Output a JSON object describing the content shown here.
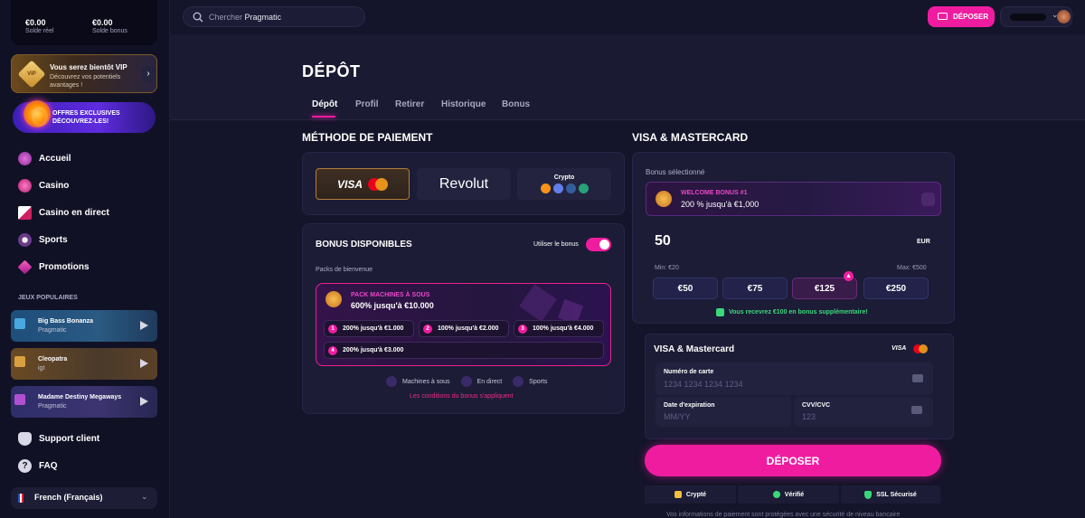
{
  "sidebar": {
    "balance_real": "€0.00",
    "balance_real_label": "Solde réel",
    "balance_bonus": "€0.00",
    "balance_bonus_label": "Solde bonus",
    "vip": {
      "badge": "VIP",
      "title": "Vous serez bientôt VIP",
      "subtitle": "Découvrez vos potentiels avantages !"
    },
    "promo_banner": {
      "line1": "OFFRES EXCLUSIVES",
      "line2": "DÉCOUVREZ-LES!"
    },
    "nav": [
      {
        "label": "Accueil",
        "icon": "home-icon"
      },
      {
        "label": "Casino",
        "icon": "slot-machine-icon"
      },
      {
        "label": "Casino en direct",
        "icon": "cards-icon"
      },
      {
        "label": "Sports",
        "icon": "soccer-ball-icon"
      },
      {
        "label": "Promotions",
        "icon": "diamond-icon"
      }
    ],
    "popular_title": "JEUX POPULAIRES",
    "games": [
      {
        "name": "Big Bass Bonanza",
        "provider": "Pragmatic",
        "color": "#1e4e7a"
      },
      {
        "name": "Cleopatra",
        "provider": "igt",
        "color": "#5a4020"
      },
      {
        "name": "Madame Destiny Megaways",
        "provider": "Pragmatic",
        "color": "#2e2e6a"
      }
    ],
    "support": "Support client",
    "faq": "FAQ",
    "language": "French (Français)"
  },
  "topbar": {
    "search_placeholder": "Chercher",
    "search_value": "Pragmatic",
    "deposit_label": "DÉPOSER"
  },
  "page": {
    "title": "DÉPÔT",
    "tabs": [
      "Dépôt",
      "Profil",
      "Retirer",
      "Historique",
      "Bonus"
    ]
  },
  "payment": {
    "title": "MÉTHODE DE PAIEMENT",
    "methods": {
      "visa": "VISA",
      "revolut": "Revolut",
      "crypto": "Crypto"
    },
    "bonus_title": "BONUS DISPONIBLES",
    "use_bonus_label": "Utiliser le bonus",
    "welcome_pack_label": "Packs de bienvenue",
    "pack": {
      "name": "PACK MACHINES À SOUS",
      "desc": "600% jusqu'à €10.000",
      "chips": [
        {
          "num": "1",
          "text": "200% jusqu'à €1.000"
        },
        {
          "num": "2",
          "text": "100% jusqu'à €2.000"
        },
        {
          "num": "3",
          "text": "100% jusqu'à €4.000"
        },
        {
          "num": "4",
          "text": "200% jusqu'à €3.000"
        }
      ]
    },
    "categories": [
      "Machines à sous",
      "En direct",
      "Sports"
    ],
    "conditions_link": "Les conditions du bonus s'appliquent"
  },
  "visa_panel": {
    "title": "VISA & MASTERCARD",
    "selected_bonus_label": "Bonus sélectionné",
    "selected_bonus_name": "WELCOME BONUS #1",
    "selected_bonus_desc": "200 % jusqu'à €1,000",
    "amount": "50",
    "currency": "EUR",
    "min": "Min: €20",
    "max": "Max: €500",
    "presets": [
      "€50",
      "€75",
      "€125",
      "€250"
    ],
    "bonus_notice": "Vous recevrez €100 en bonus supplémentaire!",
    "card_title": "VISA & Mastercard",
    "card_brand": "VISA",
    "card_number_label": "Numéro de carte",
    "card_number_placeholder": "1234 1234 1234 1234",
    "expiry_label": "Date d'expiration",
    "expiry_placeholder": "MM/YY",
    "cvv_label": "CVV/CVC",
    "cvv_placeholder": "123",
    "deposit_button": "DÉPOSER",
    "trust": [
      "Crypté",
      "Vérifié",
      "SSL Sécurisé"
    ],
    "footer_note": "Vos informations de paiement sont protégées avec une sécurité de niveau bancaire"
  },
  "colors": {
    "accent": "#f01ca0",
    "bg": "#14142a",
    "panel": "#1c1c36"
  }
}
